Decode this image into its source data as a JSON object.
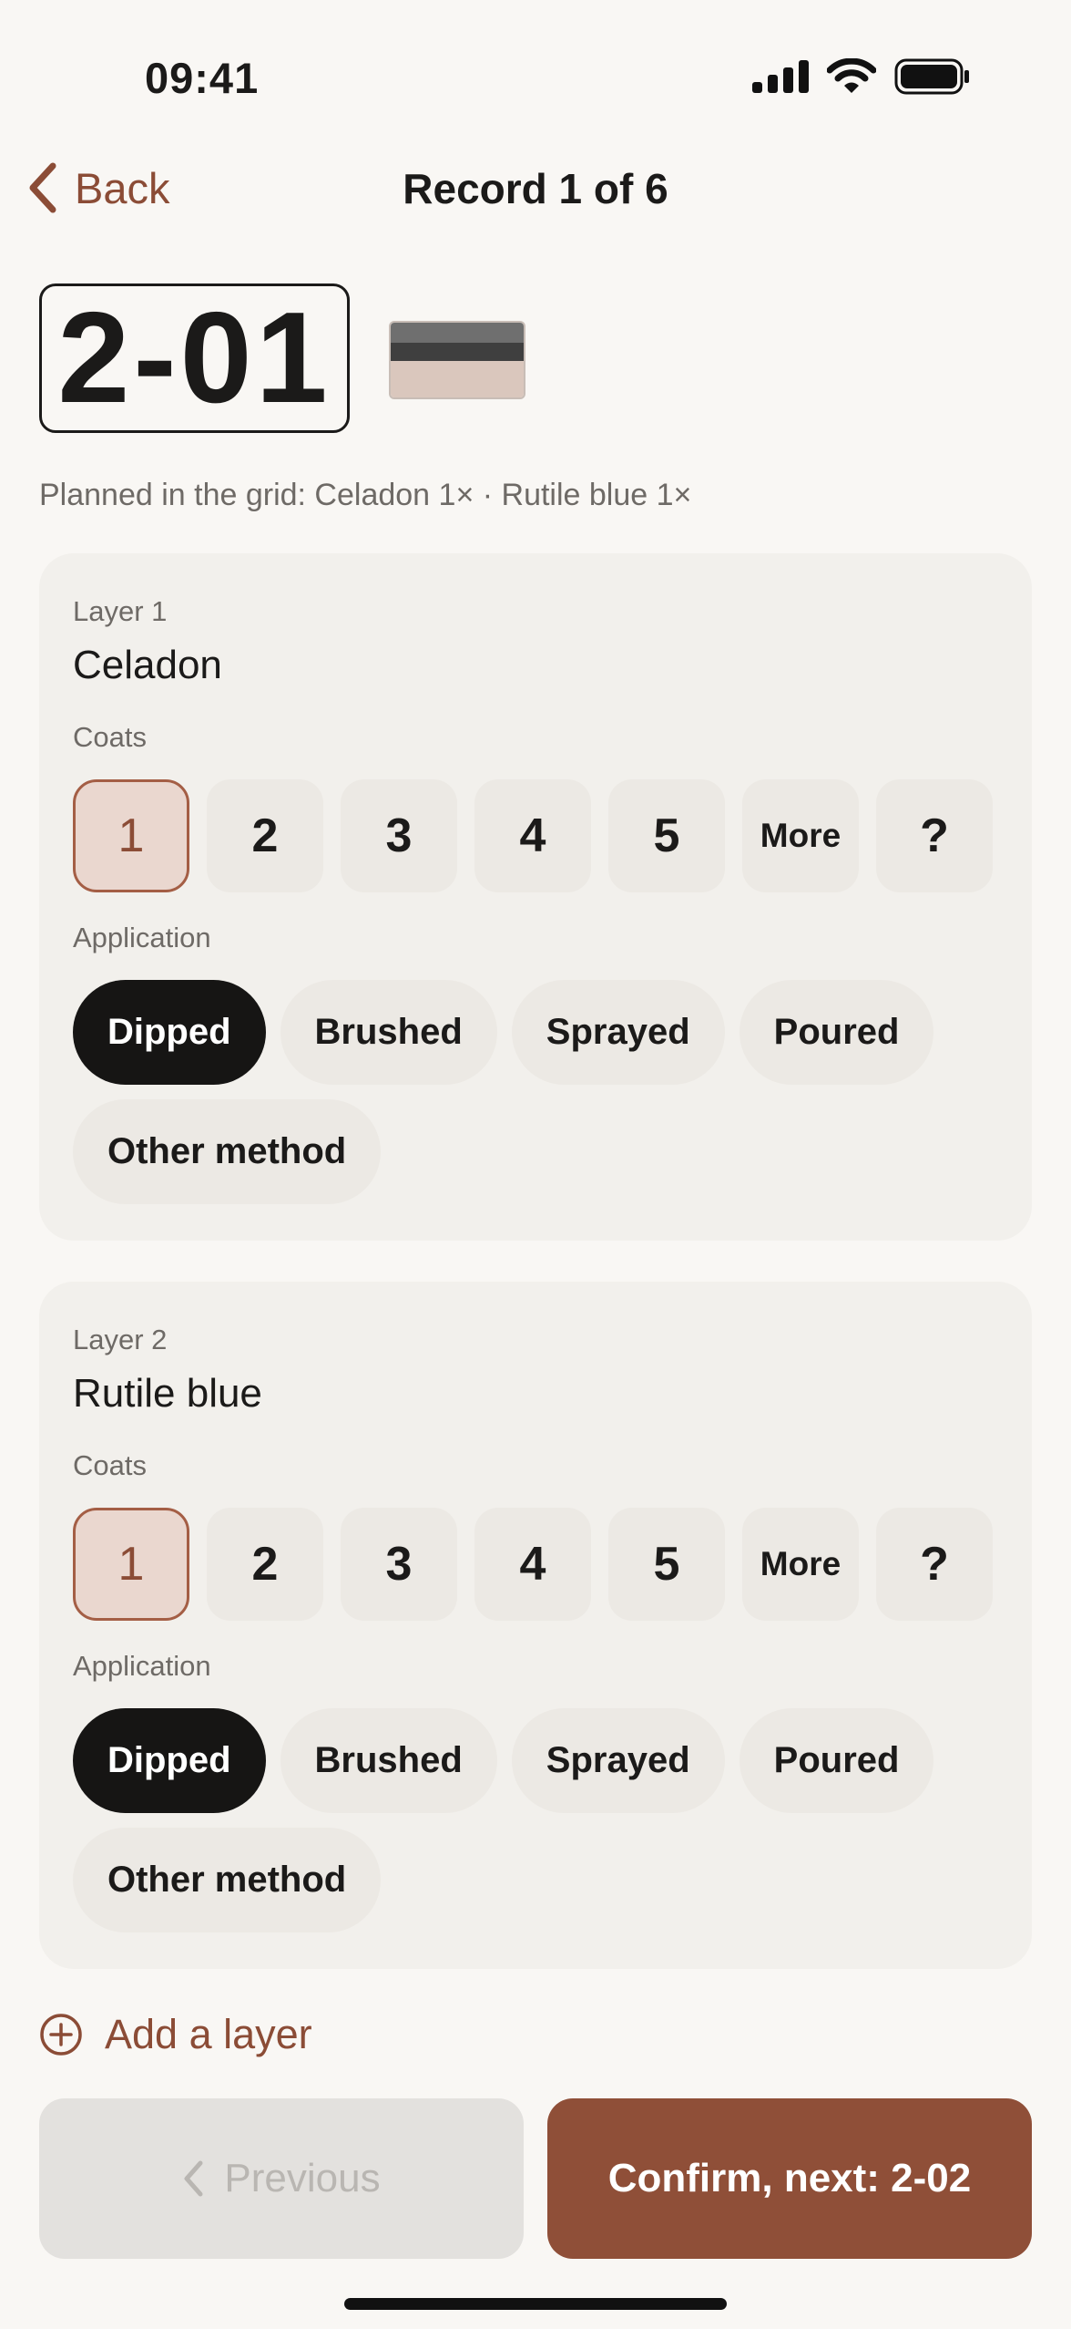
{
  "status": {
    "time": "09:41"
  },
  "nav": {
    "back_label": "Back",
    "title": "Record 1 of 6"
  },
  "record": {
    "id": "2-01",
    "planned": "Planned in the grid: Celadon 1× · Rutile blue 1×"
  },
  "common": {
    "coats_label": "Coats",
    "application_label": "Application",
    "coat_options": [
      "1",
      "2",
      "3",
      "4",
      "5",
      "More",
      "?"
    ],
    "methods": [
      "Dipped",
      "Brushed",
      "Sprayed",
      "Poured",
      "Other method"
    ]
  },
  "layers": [
    {
      "label": "Layer 1",
      "name": "Celadon",
      "selected_coats": "1",
      "selected_method": "Dipped"
    },
    {
      "label": "Layer 2",
      "name": "Rutile blue",
      "selected_coats": "1",
      "selected_method": "Dipped"
    }
  ],
  "add_layer_label": "Add a layer",
  "footer": {
    "previous_label": "Previous",
    "next_label": "Confirm, next: 2-02"
  },
  "colors": {
    "accent": "#8f4f38",
    "selected_chip": "#161514",
    "swatch": [
      "#6f6f6f",
      "#3f3f3f",
      "#dac7bd"
    ]
  }
}
